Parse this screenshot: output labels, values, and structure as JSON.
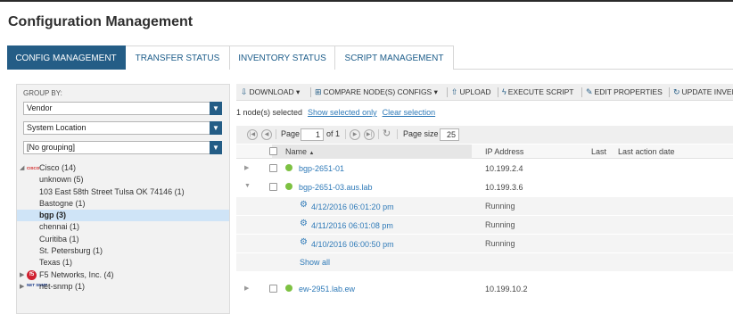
{
  "page_title": "Configuration Management",
  "tabs": [
    {
      "label": "CONFIG MANAGEMENT",
      "active": true
    },
    {
      "label": "TRANSFER STATUS",
      "active": false
    },
    {
      "label": "INVENTORY STATUS",
      "active": false
    },
    {
      "label": "SCRIPT MANAGEMENT",
      "active": false
    }
  ],
  "groupby": {
    "label": "GROUP BY:",
    "selects": [
      "Vendor",
      "System Location",
      "[No grouping]"
    ]
  },
  "tree": {
    "cisco": {
      "label": "Cisco (14)",
      "logo": "CISCO"
    },
    "cisco_children": [
      "unknown (5)",
      "103 East 58th Street Tulsa OK 74146 (1)",
      "Bastogne (1)",
      "bgp (3)",
      "chennai (1)",
      "Curitiba (1)",
      "St. Petersburg (1)",
      "Texas (1)"
    ],
    "f5": {
      "label": "F5 Networks, Inc. (4)",
      "logo": "f5"
    },
    "netsnmp": {
      "label": "net-snmp (1)",
      "logo": "NET SNMP"
    }
  },
  "toolbar": {
    "download": "DOWNLOAD",
    "compare": "COMPARE NODE(S) CONFIGS",
    "upload": "UPLOAD",
    "execute": "EXECUTE SCRIPT",
    "edit": "EDIT PROPERTIES",
    "update": "UPDATE INVENT"
  },
  "selection": {
    "text": "1 node(s) selected",
    "show_selected": "Show selected only",
    "clear": "Clear selection"
  },
  "pager": {
    "page_label": "Page",
    "page_value": "1",
    "of_label": "of 1",
    "size_label": "Page size",
    "size_value": "25"
  },
  "grid": {
    "col_name": "Name",
    "col_ip": "IP Address",
    "col_last": "Last",
    "col_last_action": "Last action date"
  },
  "rows": [
    {
      "name": "bgp-2651-01",
      "ip": "10.199.2.4"
    },
    {
      "name": "bgp-2651-03.aus.lab",
      "ip": "10.199.3.6"
    },
    {
      "name": "ew-2951.lab.ew",
      "ip": "10.199.10.2"
    }
  ],
  "subrows": [
    {
      "date": "4/12/2016 06:01:20 pm",
      "status": "Running"
    },
    {
      "date": "4/11/2016 06:01:08 pm",
      "status": "Running"
    },
    {
      "date": "4/10/2016 06:00:50 pm",
      "status": "Running"
    }
  ],
  "show_all": "Show all",
  "colors": {
    "accent": "#245d86",
    "link": "#2f7ab8",
    "status_ok": "#7dc142"
  }
}
